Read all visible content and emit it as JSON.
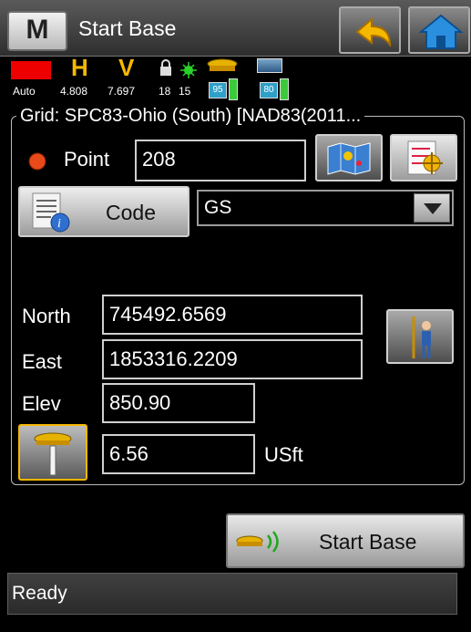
{
  "window": {
    "menu_letter": "M",
    "title": "Start Base"
  },
  "status_strip": {
    "mode": "Auto",
    "h_label": "H",
    "v_label": "V",
    "h_value": "4.808",
    "v_value": "7.697",
    "satellites_tracked": "18",
    "satellites_used": "15",
    "receiver_battery": "95",
    "controller_battery": "80",
    "colors": {
      "no_fix": "#e00000",
      "accent": "#f5b800",
      "battery": "#3cc93c"
    }
  },
  "group": {
    "title": "Grid: SPC83-Ohio (South) [NAD83(2011..."
  },
  "point": {
    "label": "Point",
    "value": "208"
  },
  "code": {
    "button_label": "Code",
    "selected": "GS"
  },
  "coordinates": {
    "north_label": "North",
    "north_value": "745492.6569",
    "east_label": "East",
    "east_value": "1853316.2209",
    "elev_label": "Elev",
    "elev_value": "850.90"
  },
  "antenna": {
    "height_value": "6.56",
    "unit": "USft"
  },
  "actions": {
    "start_base_label": "Start Base"
  },
  "statusbar": {
    "text": "Ready"
  },
  "icons": [
    "menu-icon",
    "back-arrow-icon",
    "home-icon",
    "lock-icon",
    "satellite-icon",
    "receiver-icon",
    "battery-icon",
    "map-icon",
    "list-pick-icon",
    "code-info-icon",
    "dropdown-arrow-icon",
    "instrument-height-icon",
    "measure-icon",
    "radio-signal-icon"
  ]
}
